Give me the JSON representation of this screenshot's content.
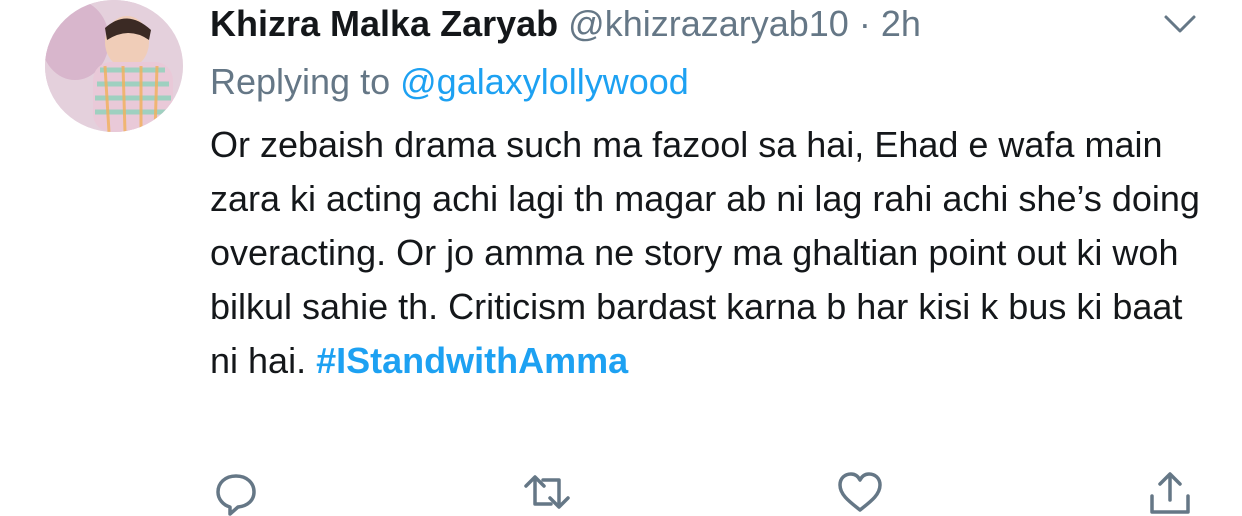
{
  "tweet": {
    "display_name": "Khizra Malka Zaryab",
    "handle": "@khizrazaryab10",
    "separator": "·",
    "time": "2h",
    "replying_prefix": "Replying to",
    "replying_to": "@galaxylollywood",
    "text": "Or zebaish drama such ma fazool sa hai, Ehad e wafa main zara ki acting achi lagi th magar ab ni lag rahi achi she’s doing overacting. Or jo amma ne story ma ghaltian point out ki woh bilkul sahie th. Criticism bardast karna b har kisi k bus ki baat ni hai.",
    "hashtag": "#IStandwithAmma"
  },
  "icons": {
    "more": "chevron-down-icon",
    "reply": "speech-bubble-icon",
    "retweet": "retweet-icon",
    "like": "heart-icon",
    "share": "share-icon"
  },
  "colors": {
    "link": "#1da1f2",
    "muted": "#657786",
    "text": "#14171a"
  }
}
